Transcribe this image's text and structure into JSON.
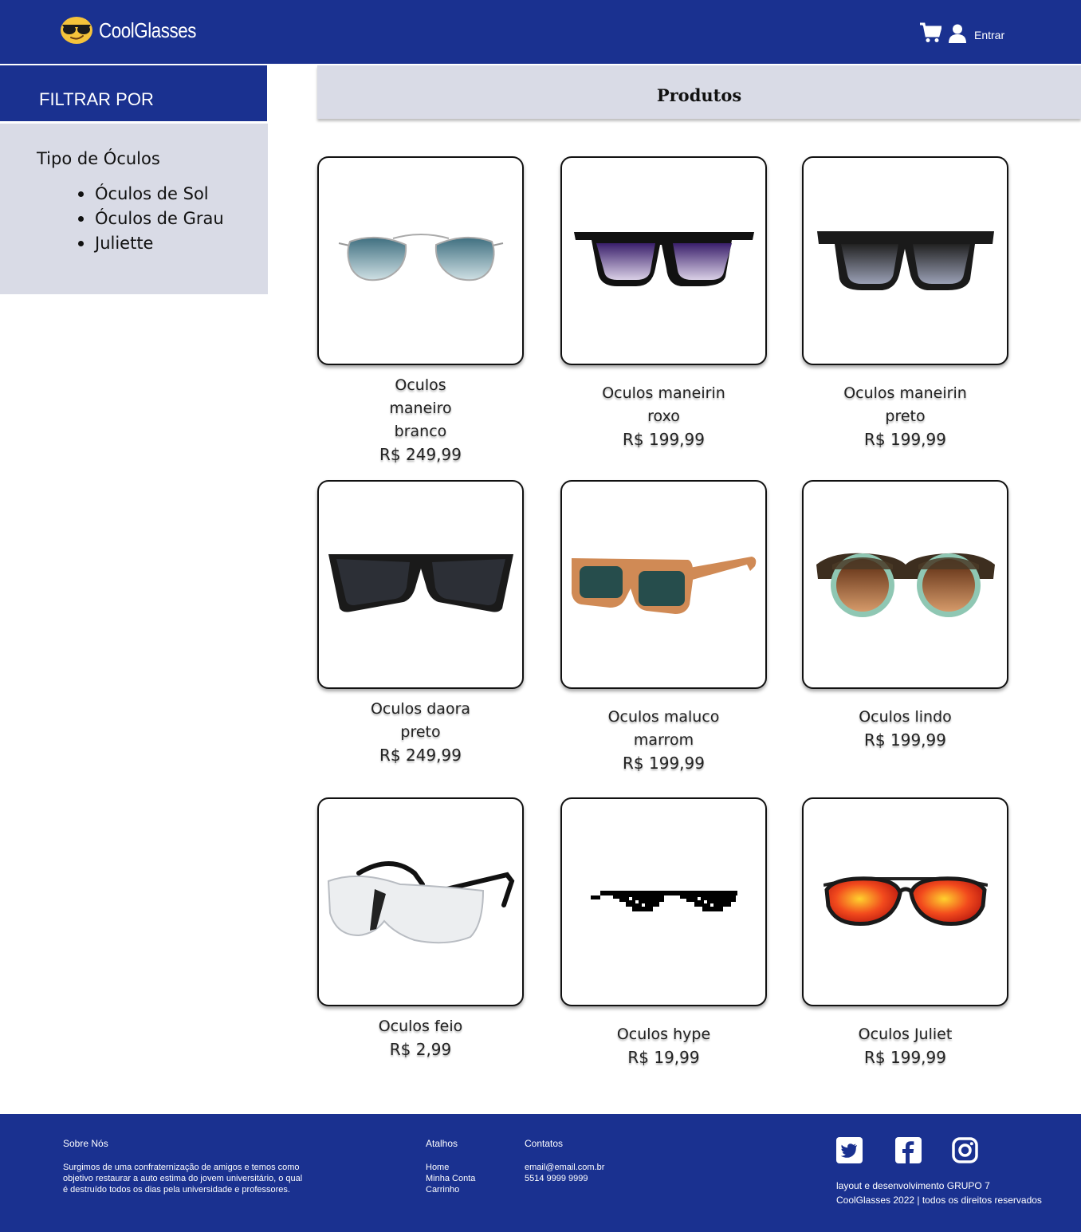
{
  "header": {
    "brand": "CoolGlasses",
    "logo_icon": "sunglasses-emoji-icon",
    "cart_icon": "cart-icon",
    "user_icon": "user-icon",
    "login_label": "Entrar",
    "color": "#1a3190"
  },
  "sidebar": {
    "title": "FILTRAR POR",
    "group_title": "Tipo de Óculos",
    "items": [
      {
        "label": "Óculos de Sol"
      },
      {
        "label": "Óculos de Grau"
      },
      {
        "label": "Juliette"
      }
    ]
  },
  "main": {
    "title": "Produtos"
  },
  "products": [
    {
      "name": "Oculos maneiro branco",
      "price": "R$ 249,99",
      "image": "aviator-blue-gradient"
    },
    {
      "name": "Oculos maneirin roxo",
      "price": "R$ 199,99",
      "image": "wayfarer-purple"
    },
    {
      "name": "Oculos maneirin preto",
      "price": "R$ 199,99",
      "image": "wayfarer-black"
    },
    {
      "name": "Oculos daora preto",
      "price": "R$ 249,99",
      "image": "cat-eye-black"
    },
    {
      "name": "Oculos maluco marrom",
      "price": "R$ 199,99",
      "image": "rectangular-tan-green"
    },
    {
      "name": "Oculos lindo",
      "price": "R$ 199,99",
      "image": "round-tortoise-mint"
    },
    {
      "name": "Oculos feio",
      "price": "R$ 2,99",
      "image": "safety-glasses-clear"
    },
    {
      "name": "Oculos hype",
      "price": "R$ 19,99",
      "image": "pixel-thug-life"
    },
    {
      "name": "Oculos Juliet",
      "price": "R$ 199,99",
      "image": "juliet-red-mirror"
    }
  ],
  "footer": {
    "about_title": "Sobre Nós",
    "about_text_1": "Surgimos de uma confraternização de amigos e temos como",
    "about_text_2": "objetivo restaurar a auto estima do jovem universitário, o qual",
    "about_text_3": "é destruído todos os dias pela universidade e professores.",
    "shortcuts_title": "Atalhos",
    "shortcuts": [
      "Home",
      "Minha Conta",
      "Carrinho"
    ],
    "contacts_title": "Contatos",
    "email": "email@email.com.br",
    "phone": "5514 9999 9999",
    "social_icons": [
      "twitter-icon",
      "facebook-icon",
      "instagram-icon"
    ],
    "credits_1": "layout e desenvolvimento GRUPO 7",
    "credits_2": "CoolGlasses 2022 | todos os direitos reservados"
  }
}
